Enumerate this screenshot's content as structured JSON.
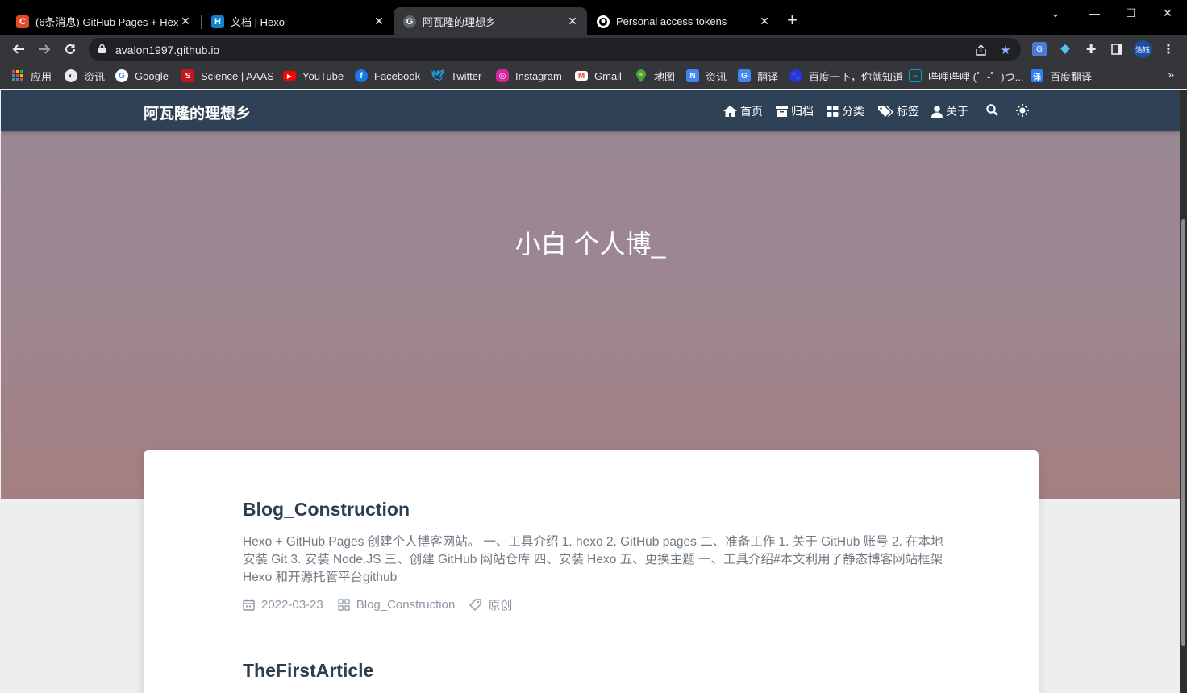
{
  "browser": {
    "tabs": [
      {
        "title": "(6条消息) GitHub Pages + Hexo",
        "favicon": "C",
        "favicon_color": "#e14d2a"
      },
      {
        "title": "文档 | Hexo",
        "favicon": "H",
        "favicon_color": "#0e83cd"
      },
      {
        "title": "阿瓦隆的理想乡",
        "favicon": "G",
        "favicon_color": "#5f6368"
      },
      {
        "title": "Personal access tokens",
        "favicon": "gh",
        "favicon_color": "#ffffff"
      }
    ],
    "url": "avalon1997.github.io",
    "profile_label": "浩钰",
    "bookmarks": [
      {
        "label": "应用",
        "icon": "apps-grid-icon",
        "color": "#ea4335"
      },
      {
        "label": "资讯",
        "icon": "globe-icon",
        "color": "#9aa0a6"
      },
      {
        "label": "Google",
        "icon": "google-icon",
        "color": "#4285f4"
      },
      {
        "label": "Science | AAAS",
        "icon": "science-icon",
        "color": "#c4161c"
      },
      {
        "label": "YouTube",
        "icon": "youtube-icon",
        "color": "#ff0000"
      },
      {
        "label": "Facebook",
        "icon": "facebook-icon",
        "color": "#1877f2"
      },
      {
        "label": "Twitter",
        "icon": "twitter-icon",
        "color": "#1da1f2"
      },
      {
        "label": "Instagram",
        "icon": "instagram-icon",
        "color": "#d6249f"
      },
      {
        "label": "Gmail",
        "icon": "gmail-icon",
        "color": "#ea4335"
      },
      {
        "label": "地图",
        "icon": "maps-icon",
        "color": "#34a853"
      },
      {
        "label": "资讯",
        "icon": "news-icon",
        "color": "#4285f4"
      },
      {
        "label": "翻译",
        "icon": "translate-icon",
        "color": "#4285f4"
      },
      {
        "label": "百度一下，你就知道",
        "icon": "baidu-icon",
        "color": "#2932e1"
      },
      {
        "label": "哔哩哔哩 (゜-゜)つ...",
        "icon": "bilibili-icon",
        "color": "#00a1d6"
      },
      {
        "label": "百度翻译",
        "icon": "baidu-translate-icon",
        "color": "#2e7cf6"
      }
    ]
  },
  "site": {
    "brand": "阿瓦隆的理想乡",
    "nav": [
      {
        "label": "首页",
        "icon": "home-icon"
      },
      {
        "label": "归档",
        "icon": "archive-icon"
      },
      {
        "label": "分类",
        "icon": "category-icon"
      },
      {
        "label": "标签",
        "icon": "tags-icon"
      },
      {
        "label": "关于",
        "icon": "user-icon"
      }
    ],
    "subtitle": "小白 个人博_"
  },
  "posts": [
    {
      "title": "Blog_Construction",
      "excerpt": "Hexo + GitHub Pages 创建个人博客网站。 一、工具介绍 1. hexo 2. GitHub pages 二、准备工作 1. 关于 GitHub 账号 2. 在本地安装 Git 3. 安装 Node.JS 三、创建 GitHub 网站仓库 四、安装 Hexo 五、更换主题 一、工具介绍#本文利用了静态博客网站框架 Hexo 和开源托管平台github",
      "date": "2022-03-23",
      "category": "Blog_Construction",
      "tag": "原创"
    },
    {
      "title": "TheFirstArticle"
    }
  ],
  "colors": {
    "nav_bg": "#2f4154",
    "title_text": "#2c3e50",
    "excerpt_text": "#717984",
    "meta_text": "#8c98a5",
    "banner_top": "#998794",
    "banner_bottom": "#a47f81"
  }
}
